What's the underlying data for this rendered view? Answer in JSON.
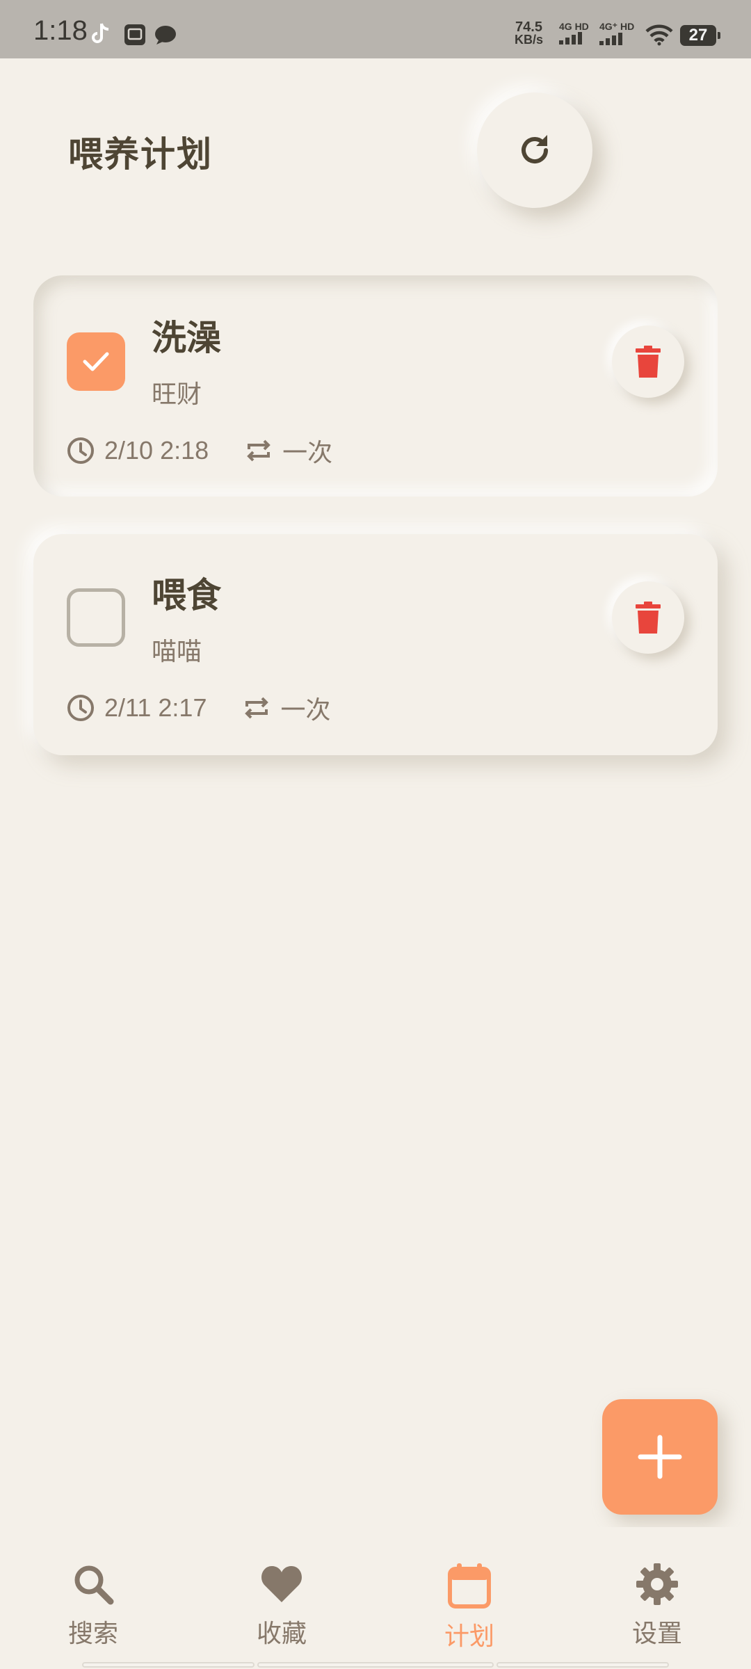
{
  "status_bar": {
    "time": "1:18",
    "network_speed_value": "74.5",
    "network_speed_unit": "KB/s",
    "sim1": "4G HD",
    "sim2": "4G⁺ HD",
    "battery": "27"
  },
  "header": {
    "title": "喂养计划",
    "refresh_icon": "refresh-icon"
  },
  "tasks": [
    {
      "title": "洗澡",
      "pet": "旺财",
      "time": "2/10 2:18",
      "repeat": "一次",
      "done": true
    },
    {
      "title": "喂食",
      "pet": "喵喵",
      "time": "2/11 2:17",
      "repeat": "一次",
      "done": false
    }
  ],
  "fab": {
    "icon": "plus-icon"
  },
  "nav": {
    "items": [
      {
        "label": "搜索",
        "icon": "search-icon"
      },
      {
        "label": "收藏",
        "icon": "heart-icon"
      },
      {
        "label": "计划",
        "icon": "calendar-icon",
        "active": true
      },
      {
        "label": "设置",
        "icon": "gear-icon"
      }
    ]
  },
  "colors": {
    "background": "#f4f0e9",
    "accent": "#fb9a67",
    "text_primary": "#4e4534",
    "text_secondary": "#86786a",
    "delete": "#e8453c"
  }
}
